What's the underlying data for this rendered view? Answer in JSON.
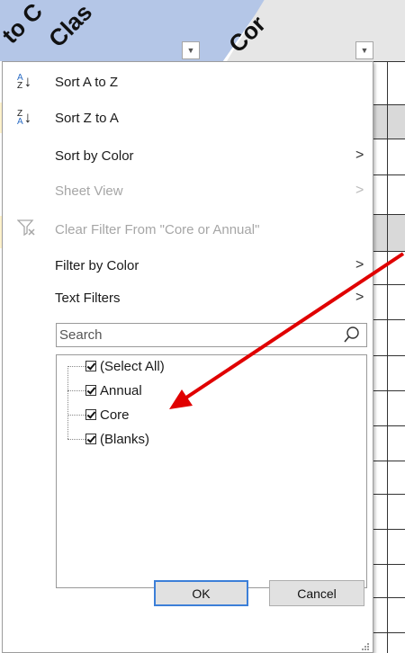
{
  "sheet": {
    "headers": [
      {
        "text": "to C",
        "fragment": "partial"
      },
      {
        "text": "Clas",
        "fragment": "partial"
      },
      {
        "text": "Cor",
        "fragment": "partial"
      }
    ],
    "header_colors": {
      "left": "#b4c6e7",
      "right": "#e6e6e6"
    },
    "filter_button_icon": "dropdown-arrow-icon",
    "row_highlights": {
      "yellow": "#fff2cc",
      "gray": "#d9d9d9"
    }
  },
  "menu": {
    "items": [
      {
        "label": "Sort A to Z",
        "icon": "sort-a-to-z-icon",
        "enabled": true,
        "submenu": false
      },
      {
        "label": "Sort Z to A",
        "icon": "sort-z-to-a-icon",
        "enabled": true,
        "submenu": false
      },
      {
        "label": "Sort by Color",
        "icon": "",
        "enabled": true,
        "submenu": true
      },
      {
        "label": "Sheet View",
        "icon": "",
        "enabled": false,
        "submenu": true
      },
      {
        "label": "Clear Filter From \"Core or Annual\"",
        "icon": "clear-filter-icon",
        "enabled": false,
        "submenu": false
      },
      {
        "label": "Filter by Color",
        "icon": "",
        "enabled": true,
        "submenu": true
      },
      {
        "label": "Text Filters",
        "icon": "",
        "enabled": true,
        "submenu": true
      }
    ],
    "sort_icon_letters": {
      "az_top": "A",
      "az_bottom": "Z",
      "za_top": "Z",
      "za_bottom": "A"
    },
    "chevron": ">",
    "search": {
      "placeholder": "Search",
      "value": "",
      "icon": "magnifier-icon"
    },
    "values_list": [
      {
        "label": "(Select All)",
        "checked": true
      },
      {
        "label": "Annual",
        "checked": true
      },
      {
        "label": "Core",
        "checked": true
      },
      {
        "label": "(Blanks)",
        "checked": true
      }
    ],
    "ok_label": "OK",
    "cancel_label": "Cancel",
    "accent_color": "#3c7fd8"
  },
  "annotation": {
    "arrow_color": "#e00000",
    "icon": "red-arrow-annotation"
  }
}
